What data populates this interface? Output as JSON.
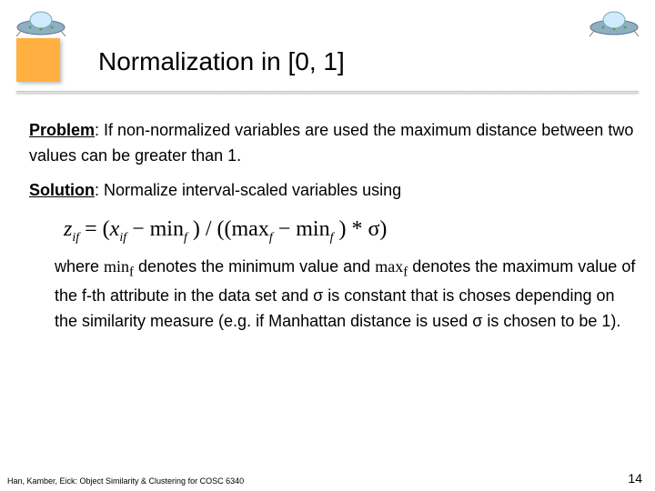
{
  "title": "Normalization in [0, 1]",
  "labels": {
    "problem": "Problem",
    "solution": "Solution"
  },
  "problem_text": ": If non-normalized variables are used the maximum distance between two values can be greater than 1.",
  "solution_text": ": Normalize interval-scaled variables using",
  "formula": {
    "lhs_var": "z",
    "lhs_sub": "if",
    "eq": " = (",
    "x_var": "x",
    "x_sub": "if",
    "minus1": " − min",
    "min_sub1": "f",
    "mid": " ) / ((max",
    "max_sub": "f",
    "minus2": " − min",
    "min_sub2": "f",
    "tail": " ) * σ)"
  },
  "explain_a": "where ",
  "minf": "min",
  "minf_sub": "f",
  "explain_b": " denotes the minimum value and ",
  "maxf": "max",
  "maxf_sub": "f",
  "explain_c": " denotes the maximum value of the f-th attribute in the data set and σ is constant that is choses depending on the similarity measure (e.g. if Manhattan distance is used σ is chosen to be 1).",
  "footer": "Han, Kamber, Eick: Object Similarity & Clustering for COSC 6340",
  "page": "14"
}
